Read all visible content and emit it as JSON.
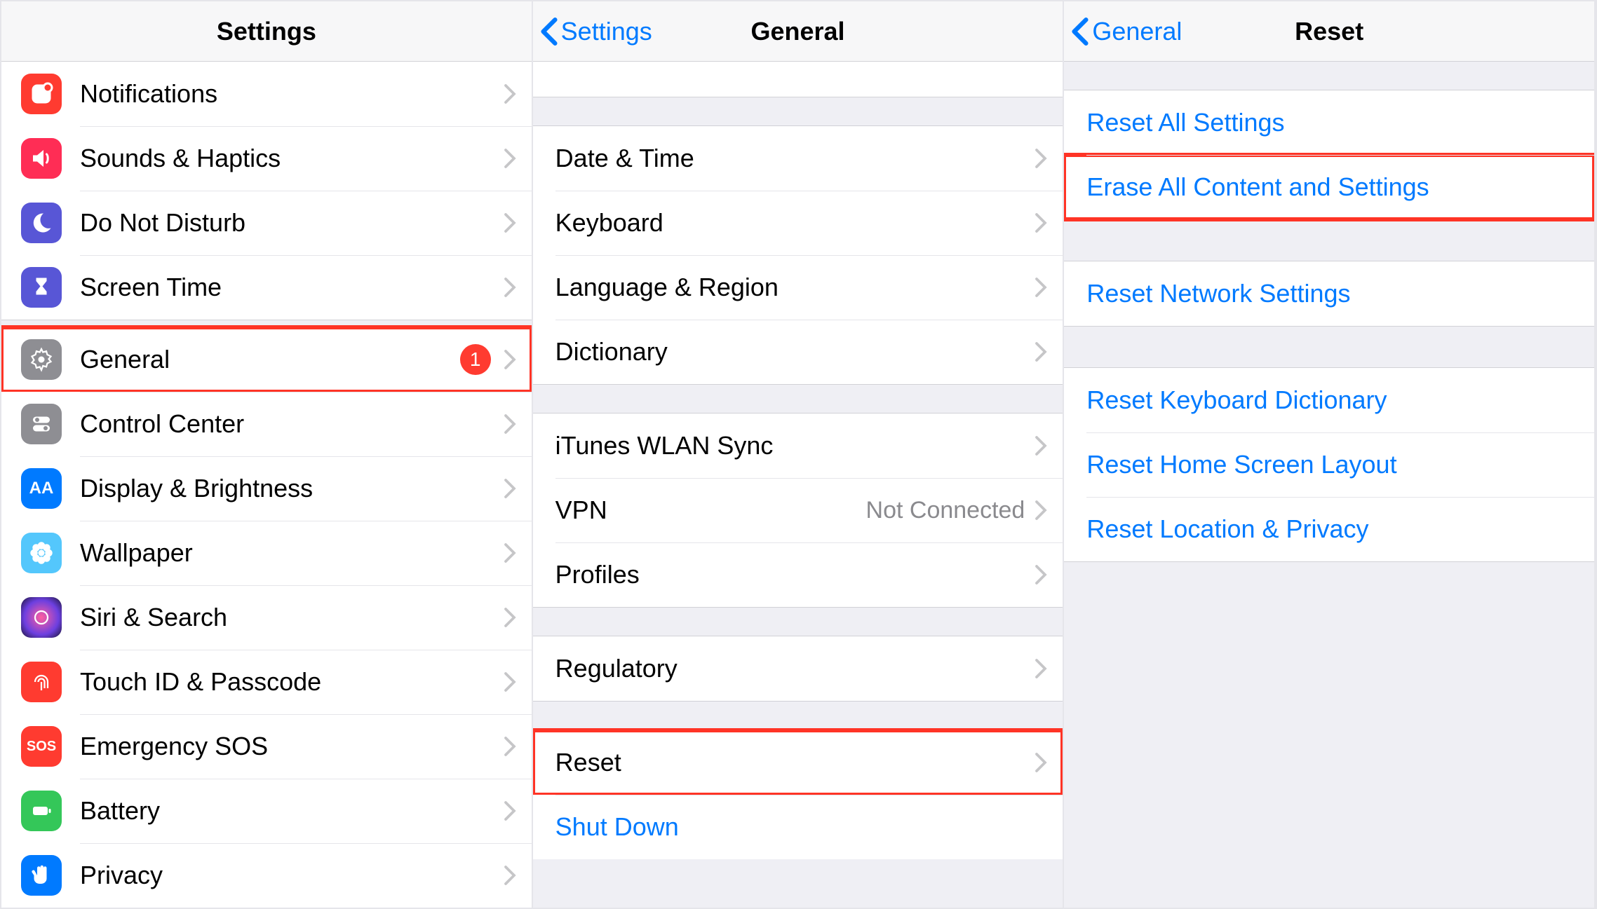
{
  "panelA": {
    "title": "Settings",
    "groups": [
      {
        "rows": [
          {
            "id": "notifications",
            "label": "Notifications",
            "iconBg": "#ff3b30",
            "icon": "notifications"
          },
          {
            "id": "sounds",
            "label": "Sounds & Haptics",
            "iconBg": "#ff2d55",
            "icon": "speaker"
          },
          {
            "id": "dnd",
            "label": "Do Not Disturb",
            "iconBg": "#5856d6",
            "icon": "moon"
          },
          {
            "id": "screentime",
            "label": "Screen Time",
            "iconBg": "#5856d6",
            "icon": "hourglass"
          }
        ]
      },
      {
        "rows": [
          {
            "id": "general",
            "label": "General",
            "iconBg": "#8e8e93",
            "icon": "gear",
            "badge": "1",
            "highlight": true
          },
          {
            "id": "controlcenter",
            "label": "Control Center",
            "iconBg": "#8e8e93",
            "icon": "switches"
          },
          {
            "id": "display",
            "label": "Display & Brightness",
            "iconBg": "#007aff",
            "icon": "aa"
          },
          {
            "id": "wallpaper",
            "label": "Wallpaper",
            "iconBg": "#54c7fc",
            "icon": "flower"
          },
          {
            "id": "siri",
            "label": "Siri & Search",
            "iconBg": "#19142b",
            "icon": "siri"
          },
          {
            "id": "touchid",
            "label": "Touch ID & Passcode",
            "iconBg": "#ff3b30",
            "icon": "fingerprint"
          },
          {
            "id": "sos",
            "label": "Emergency SOS",
            "iconBg": "#ff3b30",
            "icon": "sos"
          },
          {
            "id": "battery",
            "label": "Battery",
            "iconBg": "#34c759",
            "icon": "battery"
          },
          {
            "id": "privacy",
            "label": "Privacy",
            "iconBg": "#007aff",
            "icon": "hand"
          }
        ]
      }
    ]
  },
  "panelB": {
    "backLabel": "Settings",
    "title": "General",
    "groups": [
      {
        "cutTop": true,
        "rows": [
          {
            "id": "hidden-top",
            "label": ""
          }
        ]
      },
      {
        "rows": [
          {
            "id": "datetime",
            "label": "Date & Time"
          },
          {
            "id": "keyboard",
            "label": "Keyboard"
          },
          {
            "id": "language",
            "label": "Language & Region"
          },
          {
            "id": "dictionary",
            "label": "Dictionary"
          }
        ]
      },
      {
        "rows": [
          {
            "id": "ituneswlan",
            "label": "iTunes WLAN Sync"
          },
          {
            "id": "vpn",
            "label": "VPN",
            "detail": "Not Connected"
          },
          {
            "id": "profiles",
            "label": "Profiles"
          }
        ]
      },
      {
        "rows": [
          {
            "id": "regulatory",
            "label": "Regulatory"
          }
        ]
      },
      {
        "rows": [
          {
            "id": "reset",
            "label": "Reset",
            "highlight": true
          },
          {
            "id": "shutdown",
            "label": "Shut Down",
            "link": true,
            "noChevron": true
          }
        ]
      }
    ]
  },
  "panelC": {
    "backLabel": "General",
    "title": "Reset",
    "groups": [
      {
        "rows": [
          {
            "id": "resetall",
            "label": "Reset All Settings",
            "link": true,
            "noChevron": true
          },
          {
            "id": "eraseall",
            "label": "Erase All Content and Settings",
            "link": true,
            "noChevron": true,
            "highlight": true
          }
        ]
      },
      {
        "rows": [
          {
            "id": "resetnet",
            "label": "Reset Network Settings",
            "link": true,
            "noChevron": true
          }
        ]
      },
      {
        "rows": [
          {
            "id": "resetkeyb",
            "label": "Reset Keyboard Dictionary",
            "link": true,
            "noChevron": true
          },
          {
            "id": "resethome",
            "label": "Reset Home Screen Layout",
            "link": true,
            "noChevron": true
          },
          {
            "id": "resetloc",
            "label": "Reset Location & Privacy",
            "link": true,
            "noChevron": true
          }
        ]
      }
    ]
  }
}
